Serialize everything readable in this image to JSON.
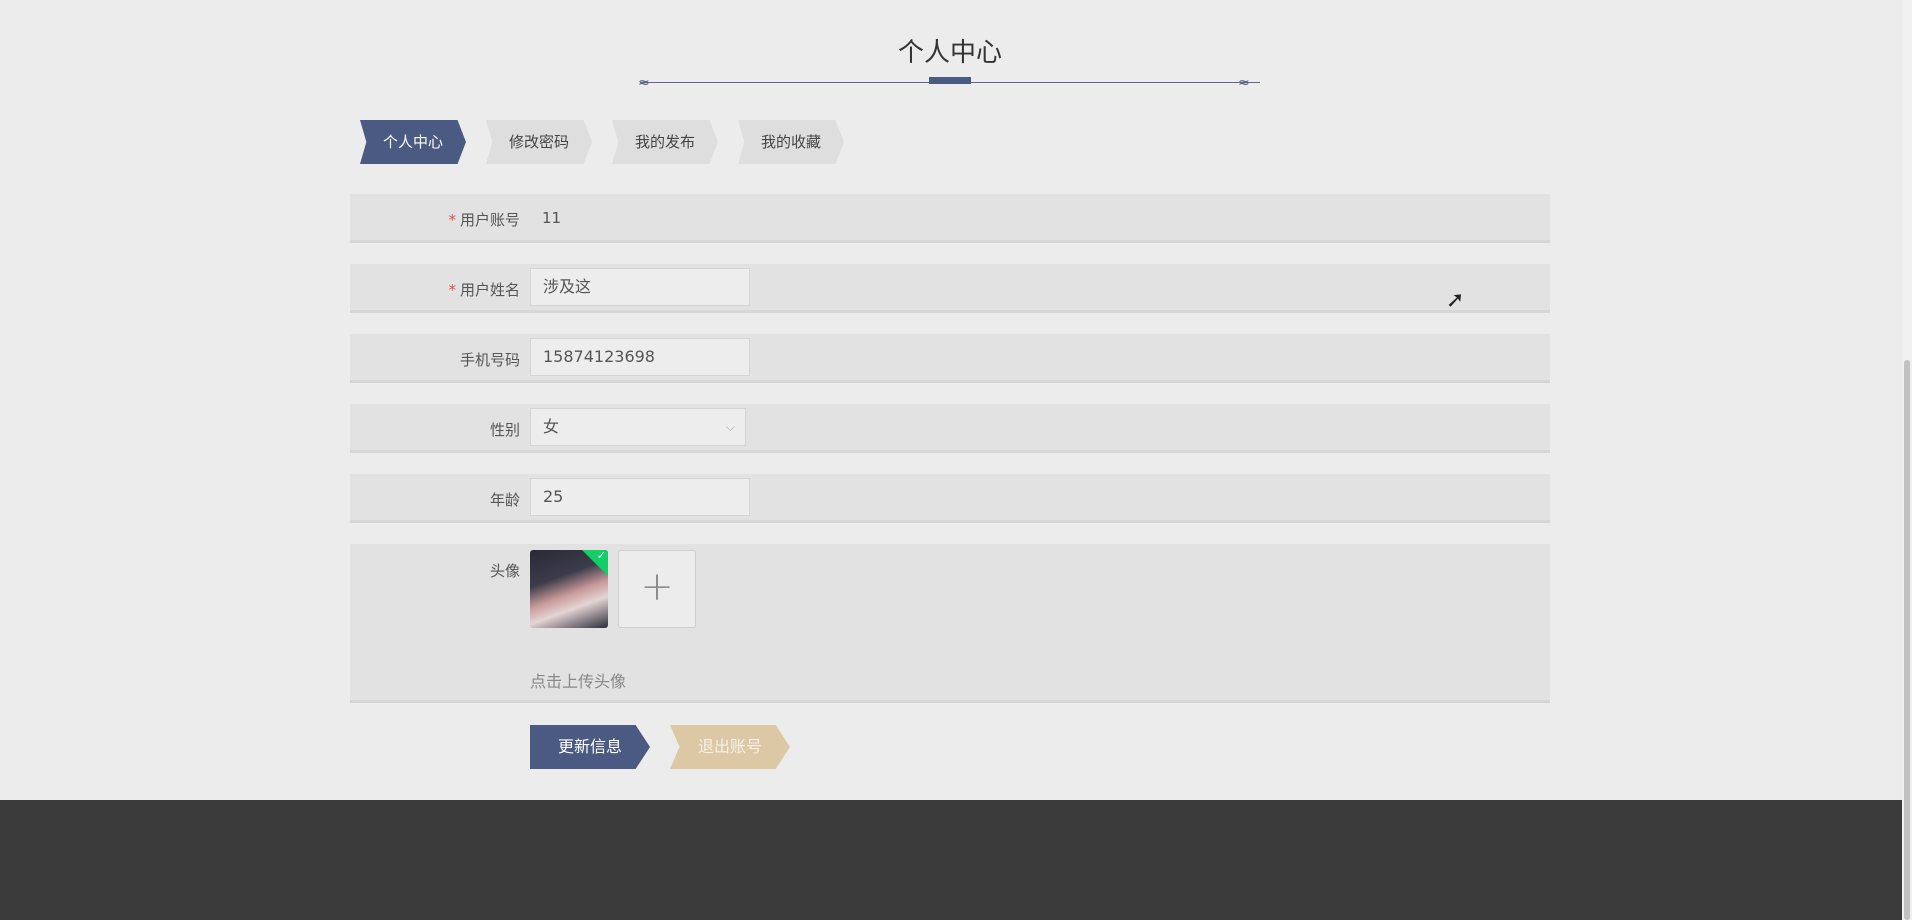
{
  "page": {
    "title": "个人中心"
  },
  "tabs": [
    {
      "label": "个人中心",
      "active": true
    },
    {
      "label": "修改密码",
      "active": false
    },
    {
      "label": "我的发布",
      "active": false
    },
    {
      "label": "我的收藏",
      "active": false
    }
  ],
  "form": {
    "account": {
      "label": "用户账号",
      "required": "*",
      "value": "11"
    },
    "name": {
      "label": "用户姓名",
      "required": "*",
      "value": "涉及这"
    },
    "phone": {
      "label": "手机号码",
      "value": "15874123698"
    },
    "gender": {
      "label": "性别",
      "value": "女"
    },
    "age": {
      "label": "年龄",
      "value": "25"
    },
    "avatar": {
      "label": "头像",
      "upload_hint": "点击上传头像",
      "add_symbol": "+",
      "check_symbol": "✓"
    }
  },
  "buttons": {
    "update": "更新信息",
    "logout": "退出账号"
  },
  "icons": {
    "select_arrow": "chevron-down-icon",
    "cursor": "mouse-pointer-icon"
  },
  "colors": {
    "primary": "#4b5a82",
    "secondary": "#dcc8a5",
    "footer": "#3b3b3b",
    "required": "#d9534f",
    "success": "#13ce66"
  }
}
